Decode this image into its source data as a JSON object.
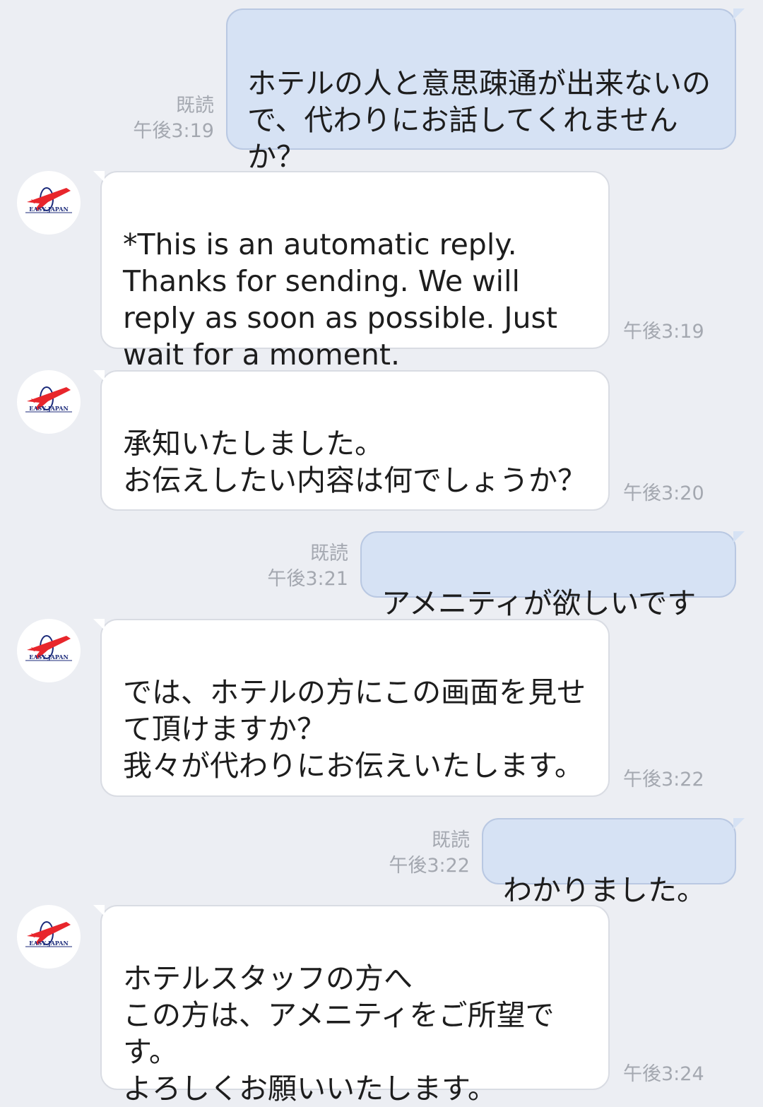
{
  "colors": {
    "background": "#eceef3",
    "outgoing_bubble": "#d6e2f4",
    "incoming_bubble": "#ffffff",
    "meta_text": "#a4a8b0",
    "logo_plane": "#e8262c",
    "logo_text": "#1b2a7a"
  },
  "contact": {
    "name": "EASY JAPAN",
    "avatar_icon": "easy-japan-plane-logo"
  },
  "messages": [
    {
      "direction": "outgoing",
      "text": "ホテルの人と意思疎通が出来ないので、代わりにお話してくれませんか？",
      "read": "既読",
      "time": "午後3:19"
    },
    {
      "direction": "incoming",
      "text": "*This is an automatic reply. Thanks for sending. We will reply as soon as possible. Just wait for a moment.",
      "time": "午後3:19"
    },
    {
      "direction": "incoming",
      "text": "承知いたしました。\nお伝えしたい内容は何でしょうか？",
      "time": "午後3:20"
    },
    {
      "direction": "outgoing",
      "text": "アメニティが欲しいです",
      "read": "既読",
      "time": "午後3:21"
    },
    {
      "direction": "incoming",
      "text": "では、ホテルの方にこの画面を見せて頂けますか？\n我々が代わりにお伝えいたします。",
      "time": "午後3:22"
    },
    {
      "direction": "outgoing",
      "text": "わかりました。",
      "read": "既読",
      "time": "午後3:22"
    },
    {
      "direction": "incoming",
      "text": "ホテルスタッフの方へ\nこの方は、アメニティをご所望です。\nよろしくお願いいたします。",
      "time": "午後3:24"
    }
  ]
}
